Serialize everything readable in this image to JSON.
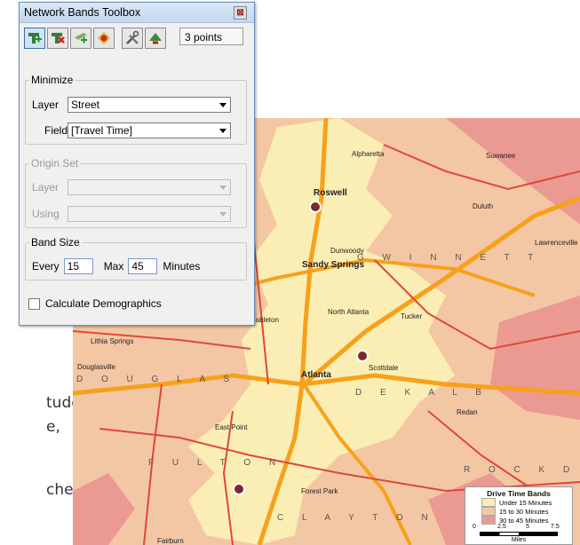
{
  "toolbox": {
    "title": "Network Bands Toolbox",
    "close_glyph": "⊠",
    "tools": [
      {
        "name": "add-point-tool",
        "icon": "add-point-icon"
      },
      {
        "name": "remove-point-tool",
        "icon": "remove-point-icon"
      },
      {
        "name": "add-layer-point-tool",
        "icon": "add-layer-point-icon"
      },
      {
        "name": "band-tool",
        "icon": "band-icon"
      },
      {
        "name": "settings-tool",
        "icon": "tools-icon"
      },
      {
        "name": "run-tool",
        "icon": "run-icon"
      }
    ],
    "point_count": "3 points",
    "minimize": {
      "legend": "Minimize",
      "layer_label": "Layer",
      "layer_value": "Street",
      "field_label": "Field",
      "field_value": "[Travel Time]"
    },
    "origin_set": {
      "legend": "Origin Set",
      "layer_label": "Layer",
      "using_label": "Using"
    },
    "band_size": {
      "legend": "Band Size",
      "every_label": "Every",
      "every_value": "15",
      "max_label": "Max",
      "max_value": "45",
      "unit": "Minutes"
    },
    "calc_demographics": {
      "label": "Calculate Demographics",
      "checked": false
    }
  },
  "doc_fragments": [
    "tude",
    "e,",
    "ched"
  ],
  "map": {
    "places": [
      "Alpharetta",
      "Roswell",
      "Dunwoody",
      "Sandy Springs",
      "North Atlanta",
      "Tucker",
      "Mableton",
      "Lithia Springs",
      "Douglasville",
      "Scottdale",
      "Atlanta",
      "Redan",
      "East Point",
      "Forest Park",
      "Fairburn",
      "Suwanee",
      "Duluth",
      "Lawrenceville"
    ],
    "regions": [
      "G W I N N E T T",
      "D O U G L A S",
      "D E K A L B",
      "F U L T O N",
      "C L A Y T O N",
      "R O C K D A L E"
    ],
    "legend": {
      "title": "Drive Time Bands",
      "items": [
        {
          "label": "Under 15 Minutes",
          "color": "#fbeeb4"
        },
        {
          "label": "15 to 30 Minutes",
          "color": "#f4c7a4"
        },
        {
          "label": "30 to 45 Minutes",
          "color": "#ea9a92"
        }
      ],
      "scale_ticks": [
        "0",
        "2.5",
        "5",
        "7.5"
      ],
      "scale_unit": "Miles"
    },
    "colors": {
      "inner": "#fbeeb4",
      "mid": "#f4c7a4",
      "outer": "#ea9a92",
      "highway": "#f7a11a",
      "road": "#e0463a"
    }
  }
}
